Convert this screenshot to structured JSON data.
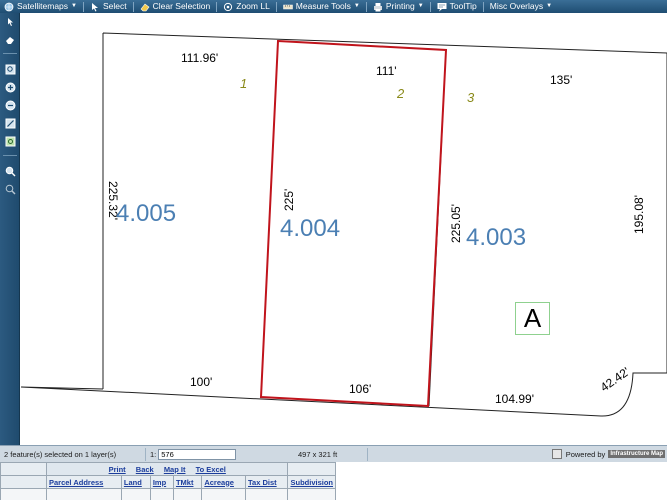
{
  "toolbar": {
    "items": [
      {
        "label": "Satellitemaps",
        "icon": "globe-icon",
        "dropdown": true
      },
      {
        "label": "Select",
        "icon": "cursor-icon",
        "dropdown": false
      },
      {
        "label": "Clear Selection",
        "icon": "eraser-icon",
        "dropdown": false
      },
      {
        "label": "Zoom LL",
        "icon": "zoom-target-icon",
        "dropdown": false
      },
      {
        "label": "Measure Tools",
        "icon": "ruler-icon",
        "dropdown": true
      },
      {
        "label": "Printing",
        "icon": "printer-icon",
        "dropdown": true
      },
      {
        "label": "ToolTip",
        "icon": "tooltip-icon",
        "dropdown": false
      },
      {
        "label": "Misc Overlays",
        "icon": "",
        "dropdown": true
      }
    ]
  },
  "map": {
    "dimensions": {
      "lot1_top": "111.96'",
      "lot2_top": "111'",
      "lot3_top": "135'",
      "lot1_left": "225.32'",
      "lot2_left": "225'",
      "lot3_left": "225.05'",
      "lot3_right": "195.08'",
      "lot1_bottom": "100'",
      "lot2_bottom": "106'",
      "lot3_bottom": "104.99'",
      "corner_arc": "42.42'"
    },
    "lot_numbers": {
      "lot1": "1",
      "lot2": "2",
      "lot3": "3"
    },
    "parcels": {
      "lot1": "4.005",
      "lot2": "4.004",
      "lot3": "4.003"
    },
    "zone_label": "A",
    "colors": {
      "selected_outline": "#c0141c",
      "parcel_label": "#4b7fb3",
      "lot_label": "#8a8a1a"
    }
  },
  "status": {
    "selection_text": "2 feature(s) selected on 1 layer(s)",
    "scale_prefix": "1:",
    "scale_value": "576",
    "extent_text": "497 x 321 ft",
    "powered_by": "Powered by",
    "logo_text": "Infrastructure Map"
  },
  "results": {
    "links": [
      "Print",
      "Back",
      "Map It",
      "To Excel"
    ],
    "columns": [
      "Parcel Address",
      "Land",
      "Imp",
      "TMkt",
      "Acreage",
      "Tax Dist",
      "Subdivision"
    ]
  }
}
